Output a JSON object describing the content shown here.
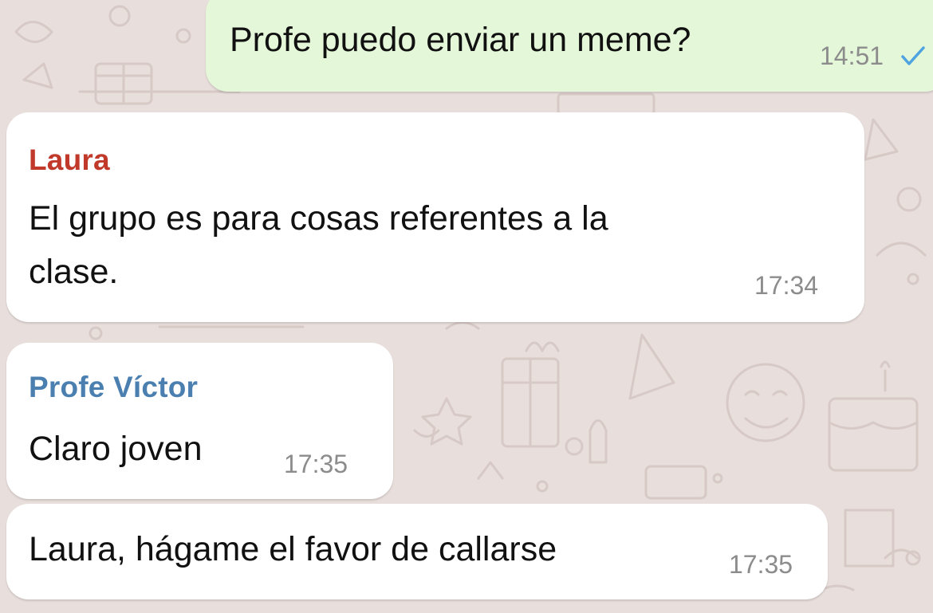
{
  "chat": {
    "messages": [
      {
        "direction": "outgoing",
        "text": "Profe puedo enviar un meme?",
        "time": "14:51",
        "status_icon": "check-icon"
      },
      {
        "direction": "incoming",
        "sender": "Laura",
        "sender_color": "#c0392b",
        "text_lines": [
          "El grupo es para cosas referentes a la",
          "clase."
        ],
        "time": "17:34"
      },
      {
        "direction": "incoming",
        "sender": "Profe Víctor",
        "sender_color": "#4a7fb0",
        "text": "Claro joven",
        "time": "17:35"
      },
      {
        "direction": "incoming",
        "text": "Laura, hágame el favor de callarse",
        "time": "17:35"
      }
    ]
  },
  "colors": {
    "background": "#e8dedb",
    "outgoing_bubble": "#e4f7d9",
    "incoming_bubble": "#ffffff",
    "timestamp": "#8c8c8c"
  }
}
